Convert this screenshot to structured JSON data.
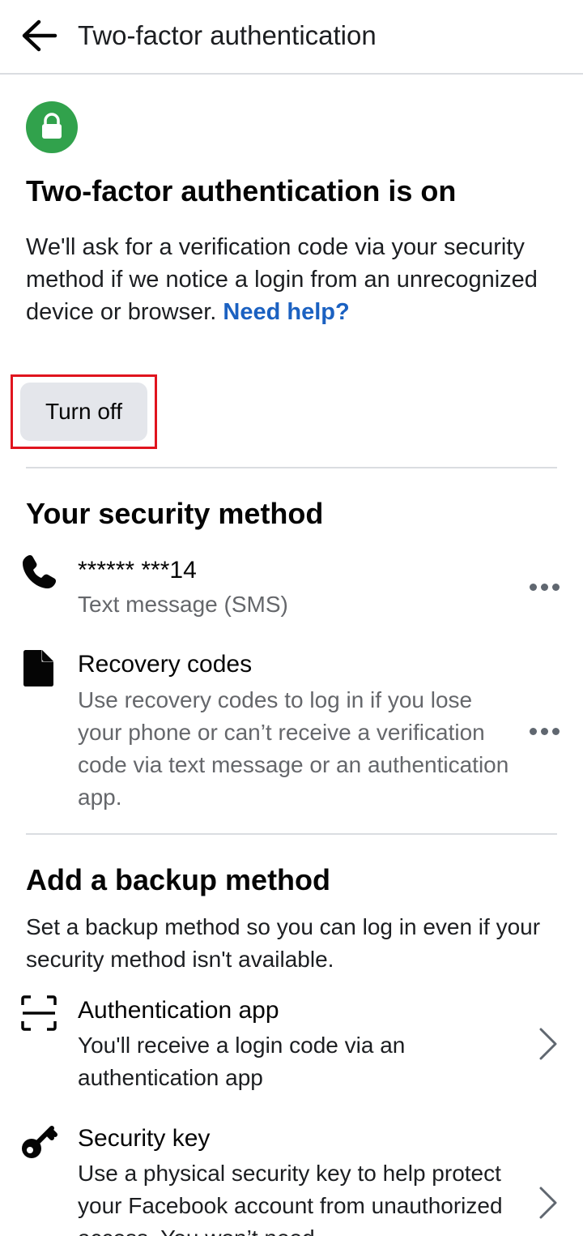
{
  "header": {
    "title": "Two-factor authentication"
  },
  "status": {
    "title": "Two-factor authentication is on",
    "description": "We'll ask for a verification code via your security method if we notice a login from an unrecognized device or browser. ",
    "help_link": "Need help?",
    "turn_off_label": "Turn off"
  },
  "security_method": {
    "title": "Your security method",
    "items": [
      {
        "title": "****** ***14",
        "subtitle": "Text message (SMS)",
        "icon": "phone-icon"
      },
      {
        "title": "Recovery codes",
        "subtitle": "Use recovery codes to log in if you lose your phone or can’t receive a verification code via text message or an authentication app.",
        "icon": "document-icon"
      }
    ]
  },
  "backup": {
    "title": "Add a backup method",
    "description": "Set a backup method so you can log in even if your security method isn't available.",
    "items": [
      {
        "title": "Authentication app",
        "subtitle": "You'll receive a login code via an authentication app",
        "icon": "scan-icon"
      },
      {
        "title": "Security key",
        "subtitle": "Use a physical security key to help protect your Facebook account from unauthorized access. You won’t need",
        "icon": "key-icon"
      }
    ]
  },
  "colors": {
    "accent_link": "#1b61c1",
    "lock_badge": "#31a24c",
    "highlight": "#e0141e"
  }
}
